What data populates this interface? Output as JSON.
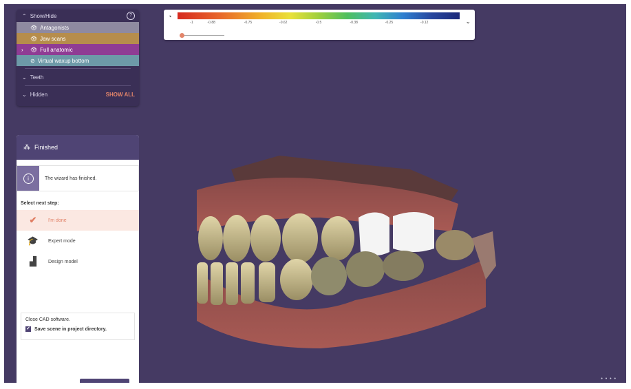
{
  "show_hide": {
    "title": "Show/Hide",
    "help_icon": "help-icon",
    "layers": [
      {
        "label": "Antagonists",
        "color": "#8f8aa0"
      },
      {
        "label": "Jaw scans",
        "color": "#b68d4c"
      },
      {
        "label": "Full anatomic",
        "color": "#8f3c94"
      },
      {
        "label": "Virtual waxup bottom",
        "color": "#6d9aa8"
      }
    ],
    "teeth_label": "Teeth",
    "hidden_label": "Hidden",
    "show_all_label": "SHOW ALL"
  },
  "color_scale": {
    "ticks": [
      "-1",
      "-0.88",
      "-0.75",
      "-0.62",
      "-0.5",
      "-0.38",
      "-0.25",
      "-0.12"
    ],
    "slider_value": 0
  },
  "wizard": {
    "title": "Finished",
    "info_text": "The wizard has finished.",
    "select_label": "Select next step:",
    "steps": [
      {
        "label": "I'm done",
        "icon": "checkmark-icon"
      },
      {
        "label": "Expert mode",
        "icon": "graduation-cap-icon"
      },
      {
        "label": "Design model",
        "icon": "model-icon"
      }
    ],
    "close_text": "Close CAD software.",
    "save_text": "Save scene in project directory.",
    "save_checked": true
  }
}
